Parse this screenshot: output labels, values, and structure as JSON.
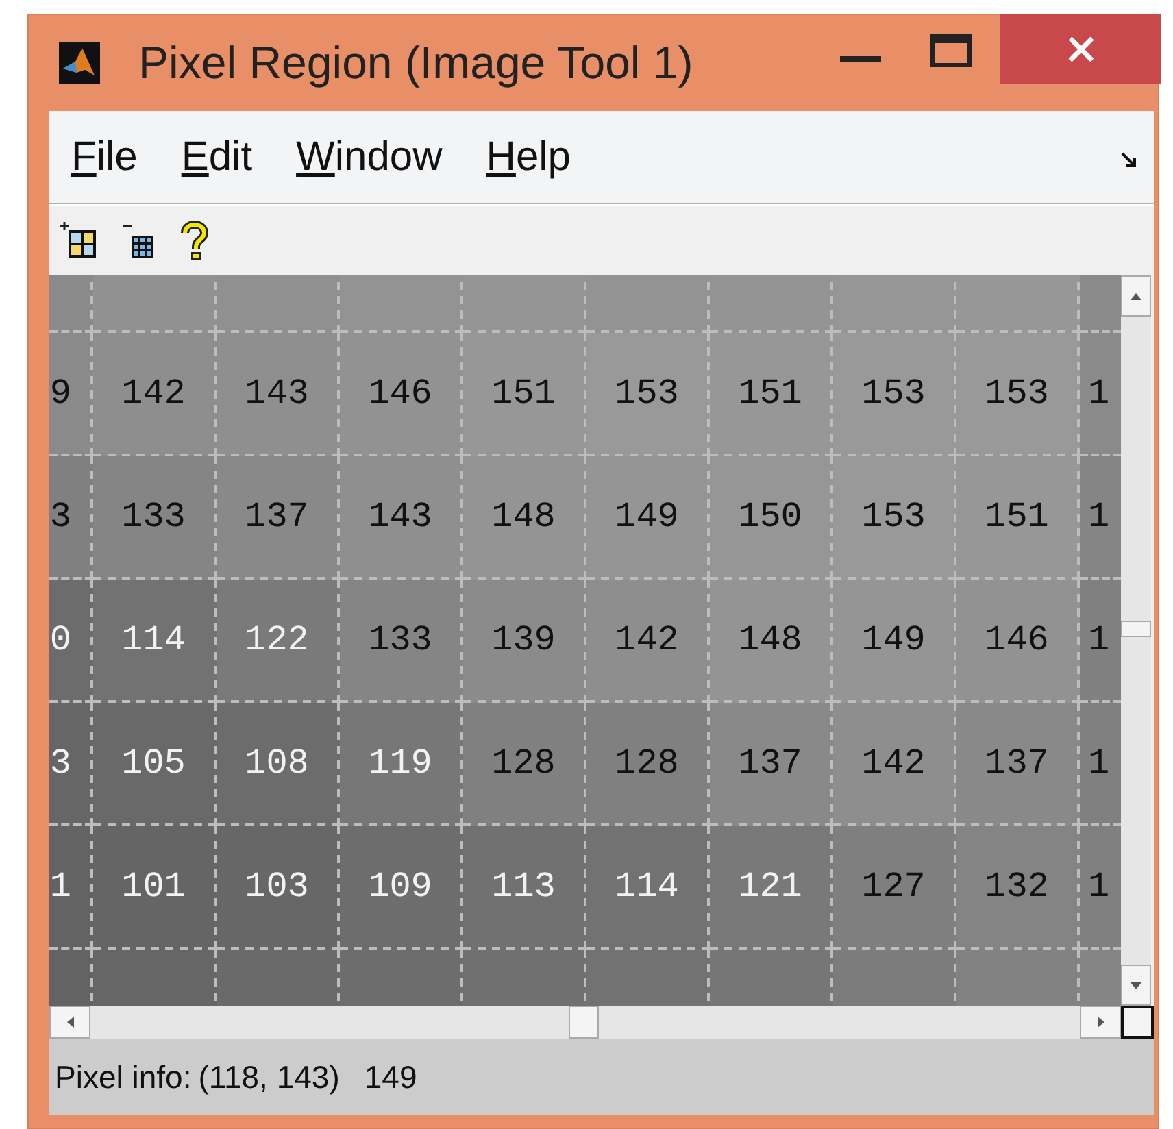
{
  "window": {
    "title": "Pixel Region (Image Tool 1)"
  },
  "menu": [
    "File",
    "Edit",
    "Window",
    "Help"
  ],
  "grid": {
    "rows": [
      [
        {
          "color": "#8a8a8a"
        },
        {
          "color": "#919191"
        },
        {
          "color": "#909090"
        },
        {
          "color": "#939393"
        },
        {
          "color": "#959595"
        },
        {
          "color": "#939393"
        },
        {
          "color": "#949494"
        },
        {
          "color": "#969696"
        },
        {
          "color": "#979797"
        },
        {
          "color": "#8a8a8a"
        }
      ],
      [
        {
          "text": "9",
          "color": "#8a8a8a"
        },
        {
          "text": "142",
          "color": "#8e8e8e"
        },
        {
          "text": "143",
          "color": "#8f8f8f"
        },
        {
          "text": "146",
          "color": "#929292"
        },
        {
          "text": "151",
          "color": "#979797"
        },
        {
          "text": "153",
          "color": "#999999"
        },
        {
          "text": "151",
          "color": "#979797"
        },
        {
          "text": "153",
          "color": "#999999"
        },
        {
          "text": "153",
          "color": "#999999"
        },
        {
          "text": "1",
          "color": "#8a8a8a"
        }
      ],
      [
        {
          "text": "3",
          "color": "#808080"
        },
        {
          "text": "133",
          "color": "#858585"
        },
        {
          "text": "137",
          "color": "#898989"
        },
        {
          "text": "143",
          "color": "#8f8f8f"
        },
        {
          "text": "148",
          "color": "#949494"
        },
        {
          "text": "149",
          "color": "#959595"
        },
        {
          "text": "150",
          "color": "#969696"
        },
        {
          "text": "153",
          "color": "#999999"
        },
        {
          "text": "151",
          "color": "#979797"
        },
        {
          "text": "1",
          "color": "#858585"
        }
      ],
      [
        {
          "text": "0",
          "color": "#6c6c6c"
        },
        {
          "text": "114",
          "color": "#727272"
        },
        {
          "text": "122",
          "color": "#7a7a7a"
        },
        {
          "text": "133",
          "color": "#858585"
        },
        {
          "text": "139",
          "color": "#8b8b8b"
        },
        {
          "text": "142",
          "color": "#8e8e8e"
        },
        {
          "text": "148",
          "color": "#949494"
        },
        {
          "text": "149",
          "color": "#959595"
        },
        {
          "text": "146",
          "color": "#929292"
        },
        {
          "text": "1",
          "color": "#808080"
        }
      ],
      [
        {
          "text": "3",
          "color": "#666666"
        },
        {
          "text": "105",
          "color": "#696969"
        },
        {
          "text": "108",
          "color": "#6c6c6c"
        },
        {
          "text": "119",
          "color": "#777777"
        },
        {
          "text": "128",
          "color": "#808080"
        },
        {
          "text": "128",
          "color": "#808080"
        },
        {
          "text": "137",
          "color": "#898989"
        },
        {
          "text": "142",
          "color": "#8e8e8e"
        },
        {
          "text": "137",
          "color": "#898989"
        },
        {
          "text": "1",
          "color": "#808080"
        }
      ],
      [
        {
          "text": "1",
          "color": "#636363"
        },
        {
          "text": "101",
          "color": "#656565"
        },
        {
          "text": "103",
          "color": "#676767"
        },
        {
          "text": "109",
          "color": "#6d6d6d"
        },
        {
          "text": "113",
          "color": "#717171"
        },
        {
          "text": "114",
          "color": "#727272"
        },
        {
          "text": "121",
          "color": "#797979"
        },
        {
          "text": "127",
          "color": "#7f7f7f"
        },
        {
          "text": "132",
          "color": "#848484"
        },
        {
          "text": "1",
          "color": "#808080"
        }
      ],
      [
        {
          "color": "#636363"
        },
        {
          "color": "#666666"
        },
        {
          "color": "#6a6a6a"
        },
        {
          "color": "#6d6d6d"
        },
        {
          "color": "#707070"
        },
        {
          "color": "#727272"
        },
        {
          "color": "#767676"
        },
        {
          "color": "#7c7c7c"
        },
        {
          "color": "#828282"
        },
        {
          "color": "#858585"
        }
      ]
    ]
  },
  "status_bar": {
    "label": "Pixel info:",
    "coords": "(118, 143)",
    "value": "149"
  }
}
